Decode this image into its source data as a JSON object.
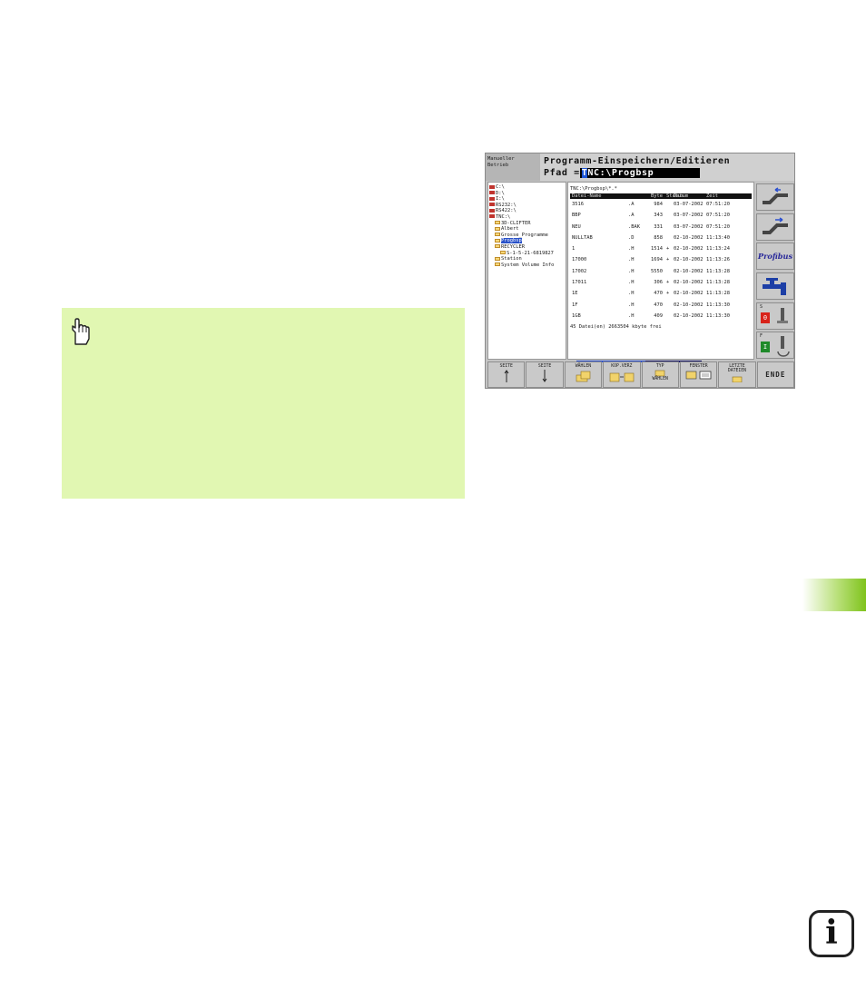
{
  "tnc": {
    "mode_lines": [
      "Manueller",
      "Betrieb"
    ],
    "title": "Programm-Einspeichern/Editieren",
    "pfad_label": "Pfad =",
    "path_cursor": "T",
    "path_rest": "NC:\\Progbsp",
    "tree": [
      {
        "label": "C:\\",
        "kind": "drive"
      },
      {
        "label": "D:\\",
        "kind": "drive"
      },
      {
        "label": "I:\\",
        "kind": "drive"
      },
      {
        "label": "RS232:\\",
        "kind": "drive"
      },
      {
        "label": "RS422:\\",
        "kind": "drive"
      },
      {
        "label": "TNC:\\",
        "kind": "drive"
      },
      {
        "label": "3D-CLIFTER",
        "kind": "folder"
      },
      {
        "label": "Albert",
        "kind": "folder"
      },
      {
        "label": "Grosse_Programme",
        "kind": "folder"
      },
      {
        "label": "Progbsp",
        "kind": "folder-selected"
      },
      {
        "label": "RECYCLER",
        "kind": "folder"
      },
      {
        "label": "S-1-5-21-6819827",
        "kind": "subfolder"
      },
      {
        "label": "Station",
        "kind": "folder"
      },
      {
        "label": "System Volume Info",
        "kind": "folder"
      }
    ],
    "cwd": "TNC:\\Progbsp\\*.*",
    "columns": [
      "Datei-Name",
      "Byte",
      "Status",
      "Datum",
      "Zeit"
    ],
    "files": [
      {
        "name": "3516",
        "ext": ".A",
        "size": "984",
        "status": "",
        "date": "03-07-2002",
        "time": "07:51:20"
      },
      {
        "name": "BBP",
        "ext": ".A",
        "size": "343",
        "status": "",
        "date": "03-07-2002",
        "time": "07:51:20"
      },
      {
        "name": "NEU",
        "ext": ".BAK",
        "size": "331",
        "status": "",
        "date": "03-07-2002",
        "time": "07:51:20"
      },
      {
        "name": "NULLTAB",
        "ext": ".D",
        "size": "858",
        "status": "",
        "date": "02-10-2002",
        "time": "11:13:40"
      },
      {
        "name": "1",
        "ext": ".H",
        "size": "1514",
        "status": "+",
        "date": "02-10-2002",
        "time": "11:13:24"
      },
      {
        "name": "17000",
        "ext": ".H",
        "size": "1694",
        "status": "+",
        "date": "02-10-2002",
        "time": "11:13:26"
      },
      {
        "name": "17002",
        "ext": ".H",
        "size": "5550",
        "status": "",
        "date": "02-10-2002",
        "time": "11:13:28"
      },
      {
        "name": "17011",
        "ext": ".H",
        "size": "306",
        "status": "+",
        "date": "02-10-2002",
        "time": "11:13:28"
      },
      {
        "name": "1E",
        "ext": ".H",
        "size": "470",
        "status": "+",
        "date": "02-10-2002",
        "time": "11:13:28"
      },
      {
        "name": "1F",
        "ext": ".H",
        "size": "470",
        "status": "",
        "date": "02-10-2002",
        "time": "11:13:30"
      },
      {
        "name": "1GB",
        "ext": ".H",
        "size": "409",
        "status": "",
        "date": "02-10-2002",
        "time": "11:13:30"
      }
    ],
    "footer": "45 Datei(en) 2663504 kbyte frei",
    "side_buttons": {
      "profibus": "Profibus",
      "s_label": "S",
      "s_value": "0",
      "f_label": "F",
      "f_value": "I"
    },
    "softkeys": [
      {
        "label": "SEITE",
        "sub": ""
      },
      {
        "label": "SEITE",
        "sub": ""
      },
      {
        "label": "WÄHLEN",
        "sub": ""
      },
      {
        "label": "KOP.VERZ",
        "sub": ""
      },
      {
        "label": "TYP",
        "sub": "WÄHLEN"
      },
      {
        "label": "FENSTER",
        "sub": ""
      },
      {
        "label": "LETZTE",
        "sub": "DATEIEN"
      },
      {
        "label": "ENDE",
        "sub": ""
      }
    ]
  },
  "colors": {
    "note_bg": "#e1f7b2",
    "chapter_tab": "#7fc31c",
    "path_cursor": "#1c55d6",
    "lamp_red": "#d8231a",
    "lamp_green": "#1f8a2a"
  },
  "icons": [
    "hand-pointer-icon",
    "info-icon"
  ]
}
